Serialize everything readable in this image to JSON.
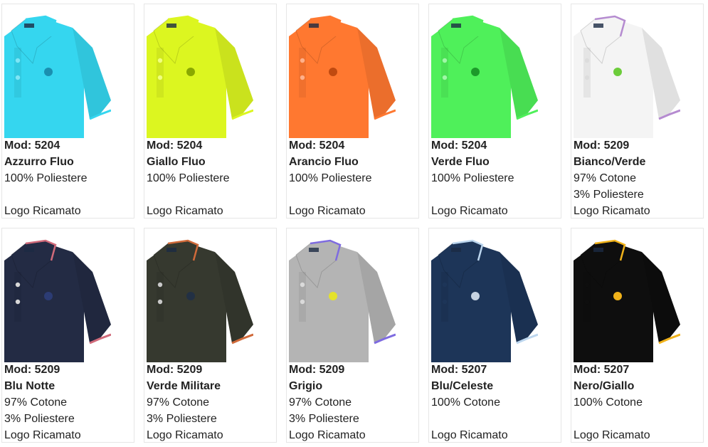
{
  "products": [
    {
      "model": "Mod: 5204",
      "color": "Azzurro Fluo",
      "material_1": "100% Poliestere",
      "material_2": "",
      "logo": "Logo Ricamato",
      "shirt_color": "#35d6ef",
      "collar_color": "#35d6ef",
      "tip_color": "#35d6ef",
      "button_color": "#7fe6f6",
      "emblem_color": "#1a8fb0"
    },
    {
      "model": "Mod: 5204",
      "color": "Giallo Fluo",
      "material_1": "100% Poliestere",
      "material_2": "",
      "logo": "Logo Ricamato",
      "shirt_color": "#dcf620",
      "collar_color": "#dcf620",
      "tip_color": "#dcf620",
      "button_color": "#f0ff80",
      "emblem_color": "#8aa800"
    },
    {
      "model": "Mod: 5204",
      "color": "Arancio Fluo",
      "material_1": "100% Poliestere",
      "material_2": "",
      "logo": "Logo Ricamato",
      "shirt_color": "#ff7830",
      "collar_color": "#ff7830",
      "tip_color": "#ff7830",
      "button_color": "#ffb08a",
      "emblem_color": "#c04a10"
    },
    {
      "model": "Mod: 5204",
      "color": "Verde Fluo",
      "material_1": "100% Poliestere",
      "material_2": "",
      "logo": "Logo Ricamato",
      "shirt_color": "#4ff05a",
      "collar_color": "#4ff05a",
      "tip_color": "#4ff05a",
      "button_color": "#9ff7a6",
      "emblem_color": "#1d9a2a"
    },
    {
      "model": "Mod: 5209",
      "color": "Bianco/Verde",
      "material_1": "97% Cotone",
      "material_2": "3% Poliestere",
      "logo": "Logo Ricamato",
      "shirt_color": "#f4f4f4",
      "collar_color": "#f4f4f4",
      "tip_color": "#b58bd0",
      "button_color": "#dcdcdc",
      "emblem_color": "#6ccc3a"
    },
    {
      "model": "Mod: 5209",
      "color": "Blu Notte",
      "material_1": "97% Cotone",
      "material_2": "3% Poliestere",
      "logo": "Logo Ricamato",
      "shirt_color": "#232b44",
      "collar_color": "#232b44",
      "tip_color": "#d06a7a",
      "button_color": "#d8d8d8",
      "emblem_color": "#2c3c74"
    },
    {
      "model": "Mod: 5209",
      "color": "Verde Militare",
      "material_1": "97% Cotone",
      "material_2": "3% Poliestere",
      "logo": "Logo Ricamato",
      "shirt_color": "#36392f",
      "collar_color": "#36392f",
      "tip_color": "#d06a3a",
      "button_color": "#c9c9c9",
      "emblem_color": "#223044"
    },
    {
      "model": "Mod: 5209",
      "color": "Grigio",
      "material_1": "97% Cotone",
      "material_2": "3% Poliestere",
      "logo": "Logo Ricamato",
      "shirt_color": "#b4b4b4",
      "collar_color": "#b4b4b4",
      "tip_color": "#7e6be0",
      "button_color": "#dadada",
      "emblem_color": "#e4e22a"
    },
    {
      "model": "Mod: 5207",
      "color": "Blu/Celeste",
      "material_1": "100% Cotone",
      "material_2": "",
      "logo": "Logo Ricamato",
      "shirt_color": "#1d3558",
      "collar_color": "#1d3558",
      "tip_color": "#bcd6ee",
      "button_color": "#1d3558",
      "emblem_color": "#c7d3e2"
    },
    {
      "model": "Mod: 5207",
      "color": "Nero/Giallo",
      "material_1": "100% Cotone",
      "material_2": "",
      "logo": "Logo Ricamato",
      "shirt_color": "#0e0e0e",
      "collar_color": "#0e0e0e",
      "tip_color": "#f0b21a",
      "button_color": "#0e0e0e",
      "emblem_color": "#f0b21a"
    }
  ]
}
